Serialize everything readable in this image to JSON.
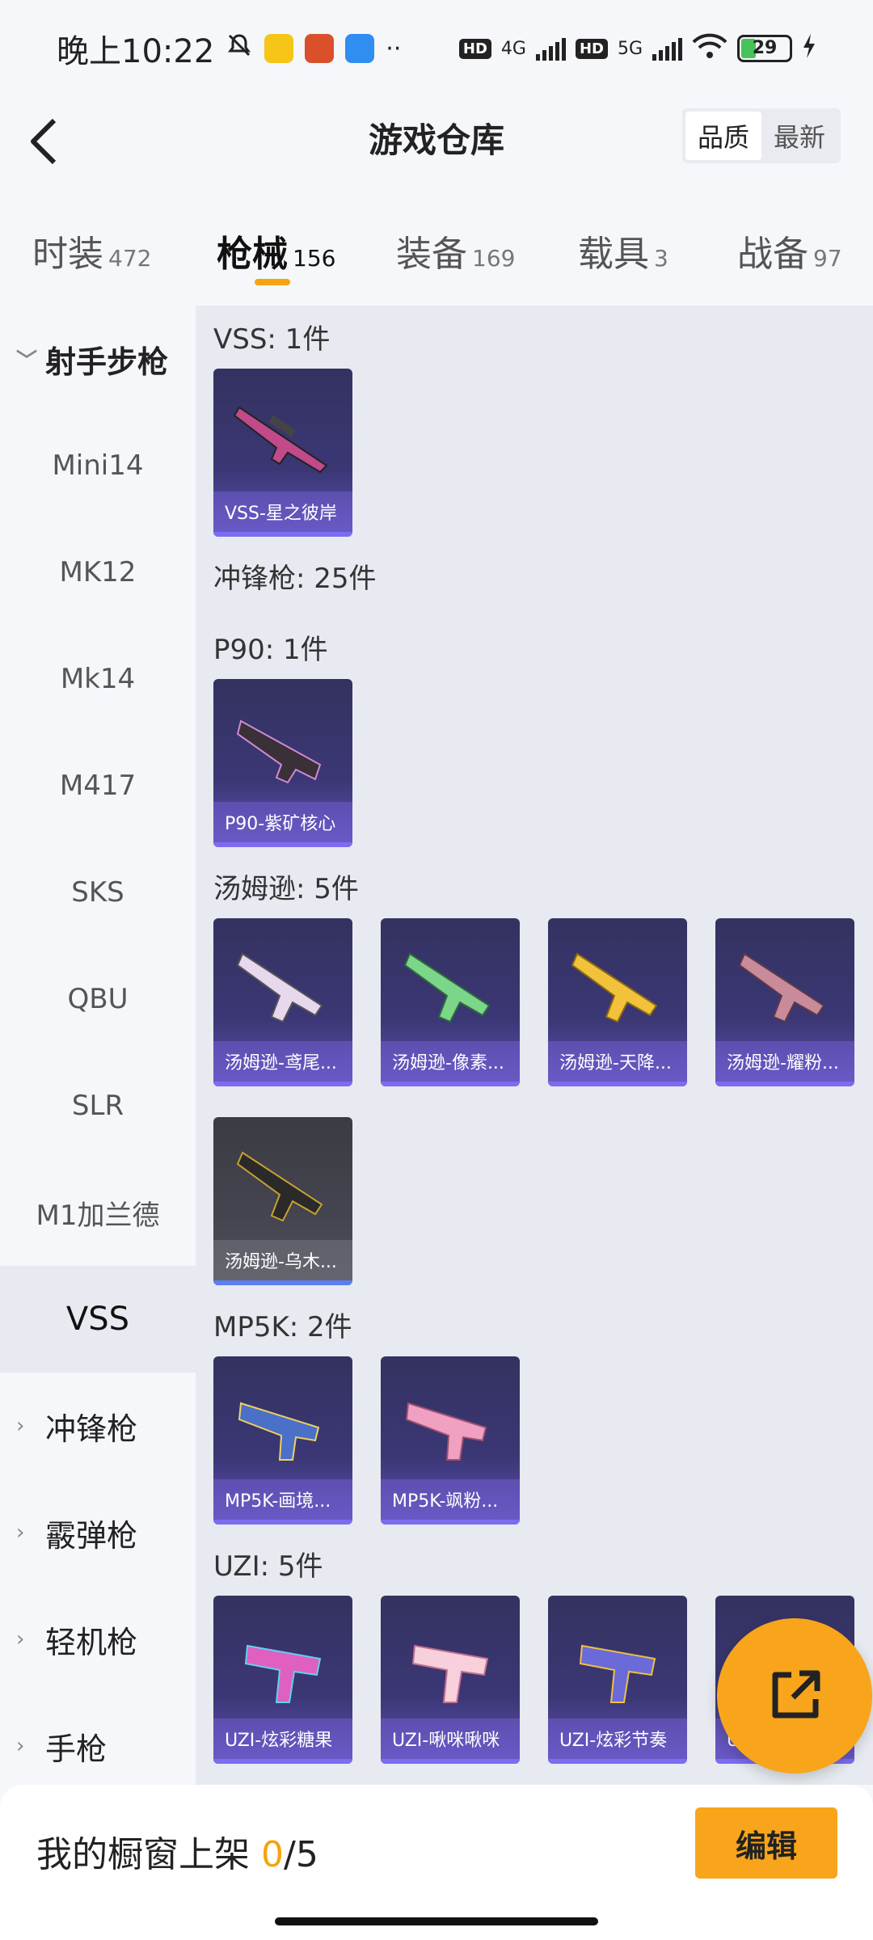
{
  "status_bar": {
    "time": "晚上10:22",
    "net1": "4G",
    "net2": "5G",
    "hd": "HD",
    "battery": "29"
  },
  "header": {
    "title": "游戏仓库",
    "sort_options": [
      "品质",
      "最新"
    ],
    "sort_selected": "品质"
  },
  "tabs": [
    {
      "label": "时装",
      "count": "472"
    },
    {
      "label": "枪械",
      "count": "156"
    },
    {
      "label": "装备",
      "count": "169"
    },
    {
      "label": "载具",
      "count": "3"
    },
    {
      "label": "战备",
      "count": "97"
    }
  ],
  "active_tab": "枪械",
  "sidebar": {
    "group_open": "射手步枪",
    "sub_items": [
      "Mini14",
      "MK12",
      "Mk14",
      "M417",
      "SKS",
      "QBU",
      "SLR",
      "M1加兰德",
      "VSS"
    ],
    "selected": "VSS",
    "groups_closed": [
      "冲锋枪",
      "霰弹枪",
      "轻机枪",
      "手枪"
    ]
  },
  "content": {
    "vss_title": "VSS: 1件",
    "vss_items": [
      "VSS-星之彼岸"
    ],
    "smg_title": "冲锋枪: 25件",
    "p90_title": "P90: 1件",
    "p90_items": [
      "P90-紫矿核心"
    ],
    "thompson_title": "汤姆逊: 5件",
    "thompson_items": [
      "汤姆逊-鸢尾...",
      "汤姆逊-像素...",
      "汤姆逊-天降...",
      "汤姆逊-耀粉...",
      "汤姆逊-乌木..."
    ],
    "mp5k_title": "MP5K: 2件",
    "mp5k_items": [
      "MP5K-画境...",
      "MP5K-飒粉..."
    ],
    "uzi_title": "UZI: 5件",
    "uzi_items": [
      "UZI-炫彩糖果",
      "UZI-啾咪啾咪",
      "UZI-炫彩节奏",
      "UZI-红色方..."
    ]
  },
  "bottom": {
    "showcase_label": "我的橱窗上架",
    "showcase_current": "0",
    "showcase_total": "/5",
    "edit_label": "编辑"
  },
  "colors": {
    "accent": "#f8a51c",
    "card_bg": "#3b3775",
    "card_bar": "#7c6cf0"
  }
}
